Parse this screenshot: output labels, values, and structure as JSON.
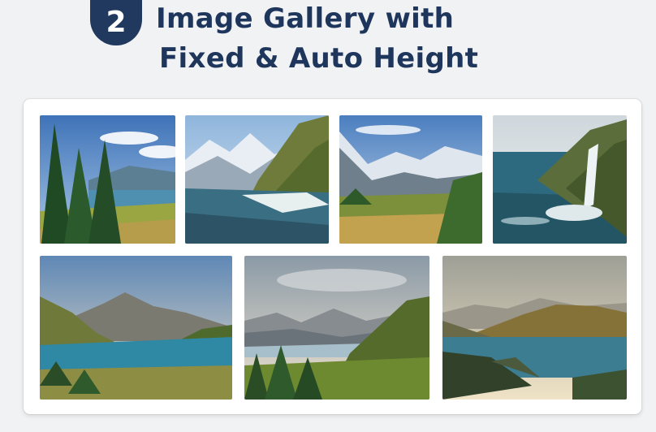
{
  "header": {
    "step_number": "2",
    "title_line1": "Image Gallery with",
    "title_line2": "Fixed & Auto Height"
  },
  "gallery": {
    "rows": [
      {
        "row": "fixed-height",
        "images": [
          {
            "name": "forest-lake"
          },
          {
            "name": "mountain-river"
          },
          {
            "name": "alpine-meadow"
          },
          {
            "name": "coastal-waterfall"
          }
        ]
      },
      {
        "row": "auto-height",
        "images": [
          {
            "name": "mountain-lake-valley"
          },
          {
            "name": "forest-mountain-panorama"
          },
          {
            "name": "fjord-sunset"
          }
        ]
      }
    ]
  },
  "colors": {
    "badge": "#22395f",
    "title": "#1f365c",
    "page_bg": "#f1f2f4",
    "card_bg": "#ffffff"
  }
}
